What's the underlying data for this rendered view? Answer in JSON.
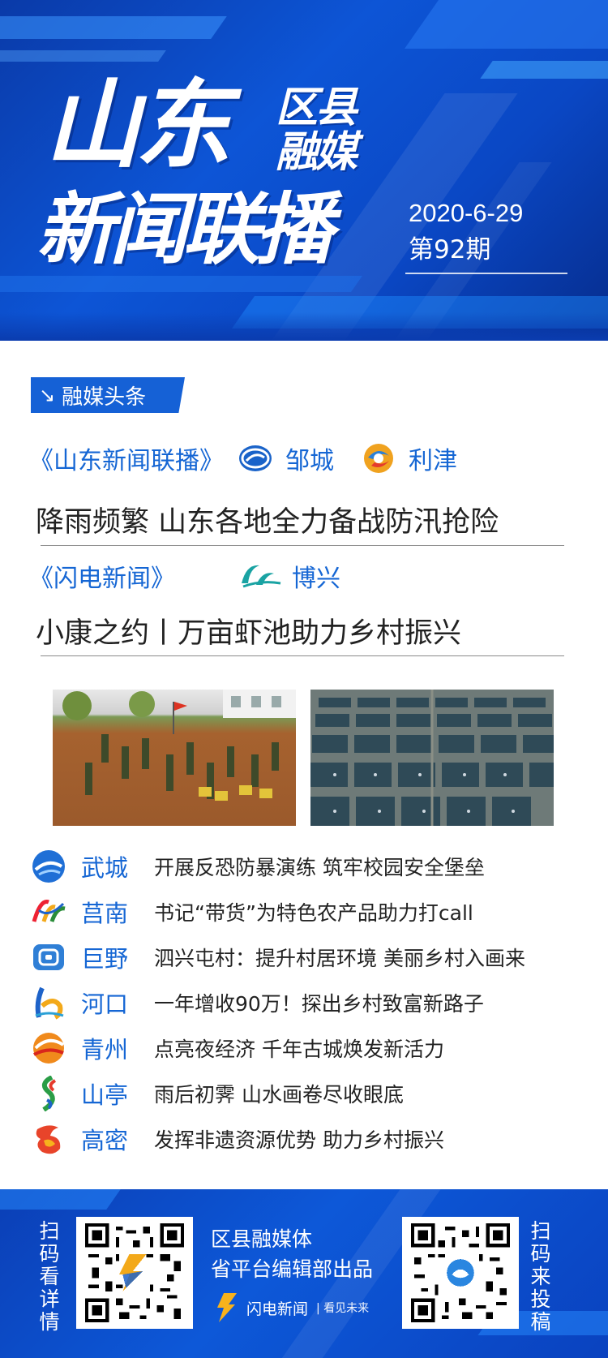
{
  "header": {
    "title_main": "山东",
    "title_side_line1": "区县",
    "title_side_line2": "融媒",
    "title_sub": "新闻联播",
    "date": "2020-6-29",
    "issue": "第92期"
  },
  "section": {
    "tag_arrow": "↘",
    "tag_label": "融媒头条"
  },
  "featured": [
    {
      "program": "《山东新闻联播》",
      "sources": [
        {
          "name": "邹城",
          "logo": "zoucheng-logo-icon"
        },
        {
          "name": "利津",
          "logo": "lijin-logo-icon"
        }
      ],
      "headline": "降雨频繁  山东各地全力备战防汛抢险"
    },
    {
      "program": "《闪电新闻》",
      "sources": [
        {
          "name": "博兴",
          "logo": "boxing-logo-icon"
        }
      ],
      "headline": "小康之约丨万亩虾池助力乡村振兴"
    }
  ],
  "photos": [
    {
      "icon": "flood-prevention-photo"
    },
    {
      "icon": "shrimp-ponds-photo"
    }
  ],
  "list": [
    {
      "county": "武城",
      "news": "开展反恐防暴演练 筑牢校园安全堡垒",
      "logo": "wucheng-logo-icon"
    },
    {
      "county": "莒南",
      "news": "书记“带货”为特色农产品助力打call",
      "logo": "junan-logo-icon"
    },
    {
      "county": "巨野",
      "news": "泗兴屯村：提升村居环境 美丽乡村入画来",
      "logo": "juye-logo-icon"
    },
    {
      "county": "河口",
      "news": "一年增收90万！探出乡村致富新路子",
      "logo": "hekou-logo-icon"
    },
    {
      "county": "青州",
      "news": "点亮夜经济 千年古城焕发新活力",
      "logo": "qingzhou-logo-icon"
    },
    {
      "county": "山亭",
      "news": "雨后初霁 山水画卷尽收眼底",
      "logo": "shanting-logo-icon"
    },
    {
      "county": "高密",
      "news": "发挥非遗资源优势 助力乡村振兴",
      "logo": "gaomi-logo-icon"
    }
  ],
  "footer": {
    "left_vertical": "扫码看详情",
    "right_vertical": "扫码来投稿",
    "credit_line1": "区县融媒体",
    "credit_line2": "省平台编辑部出品",
    "brand_name": "闪电新闻",
    "brand_slogan": "| 看见未来"
  },
  "colors": {
    "accent": "#1566d4",
    "header_blue": "#0d55d6",
    "text": "#222222"
  }
}
